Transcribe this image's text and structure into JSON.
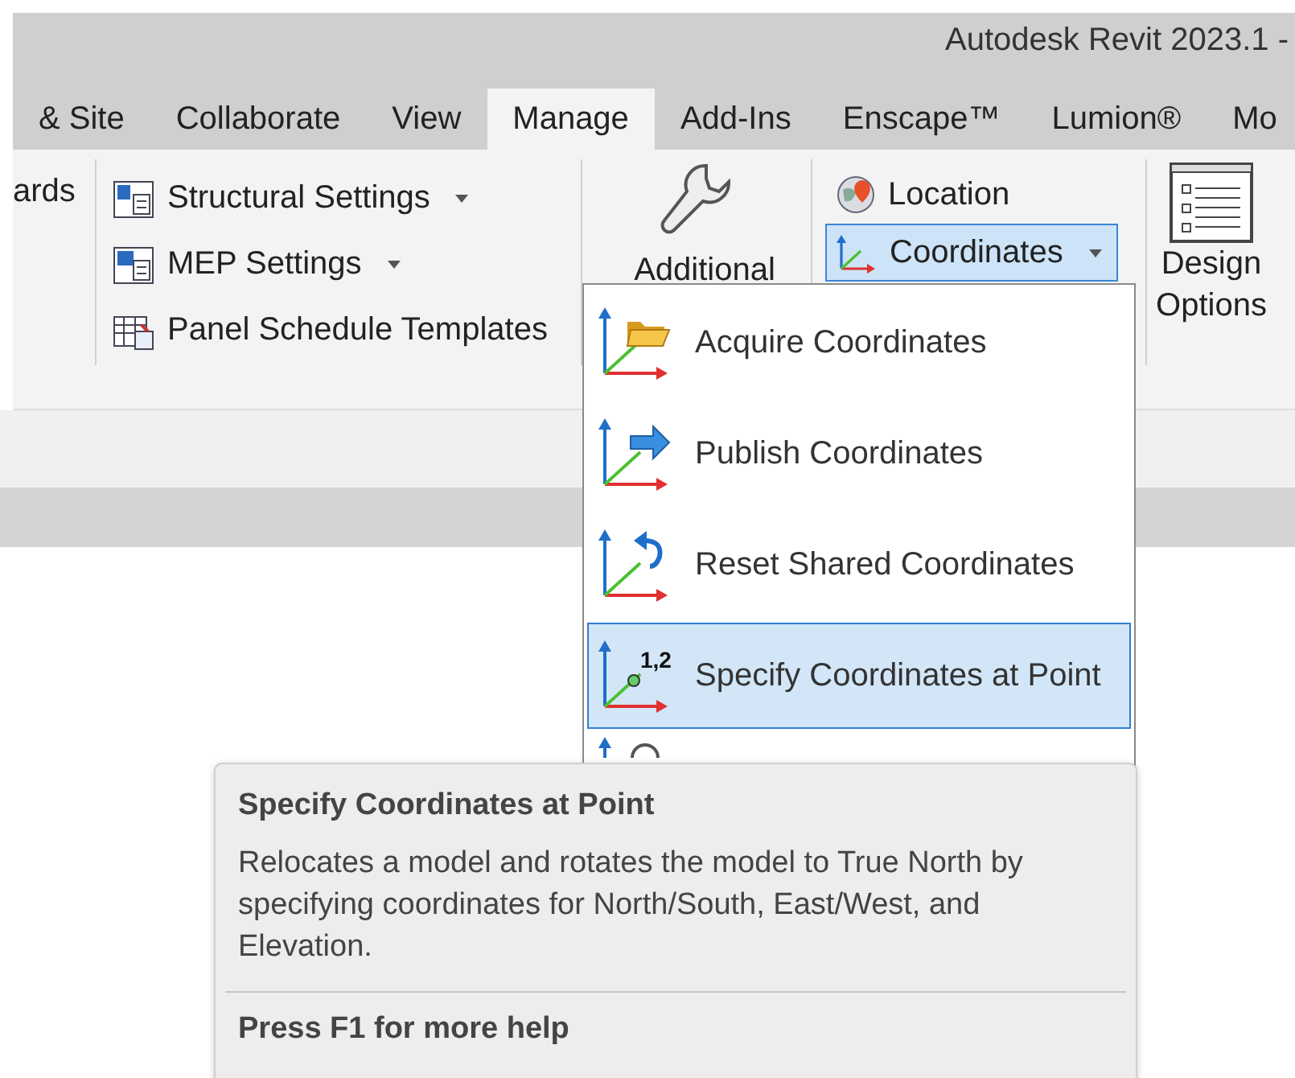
{
  "window": {
    "title": "Autodesk Revit 2023.1 -"
  },
  "tabs": [
    {
      "label": "& Site",
      "selected": false
    },
    {
      "label": "Collaborate",
      "selected": false
    },
    {
      "label": "View",
      "selected": false
    },
    {
      "label": "Manage",
      "selected": true
    },
    {
      "label": "Add-Ins",
      "selected": false
    },
    {
      "label": "Enscape™",
      "selected": false
    },
    {
      "label": "Lumion®",
      "selected": false
    },
    {
      "label": "Mo",
      "selected": false
    }
  ],
  "ribbon": {
    "cut_label": "ards",
    "settings": [
      {
        "label": "Structural  Settings",
        "kind": "structural",
        "dropdown": true
      },
      {
        "label": "MEP  Settings",
        "kind": "mep",
        "dropdown": true
      },
      {
        "label": "Panel Schedule  Templates",
        "kind": "schedule",
        "dropdown": false
      }
    ],
    "additional": {
      "label": "Additional"
    },
    "location": {
      "label": "Location"
    },
    "coordinates": {
      "label": "Coordinates",
      "expanded": true
    },
    "design_options": {
      "label": "Design Options"
    }
  },
  "menu": {
    "items": [
      {
        "label": "Acquire Coordinates",
        "kind": "acquire",
        "selected": false
      },
      {
        "label": "Publish Coordinates",
        "kind": "publish",
        "selected": false
      },
      {
        "label": "Reset Shared Coordinates",
        "kind": "reset",
        "selected": false
      },
      {
        "label": "Specify Coordinates at Point",
        "kind": "specify",
        "icon_label": "1,2",
        "selected": true
      },
      {
        "kind": "partial",
        "selected": false
      }
    ]
  },
  "tooltip": {
    "title": "Specify Coordinates at Point",
    "description": "Relocates a model and rotates the model to True North by specifying coordinates for North/South, East/West, and Elevation.",
    "help": "Press F1 for more help"
  }
}
